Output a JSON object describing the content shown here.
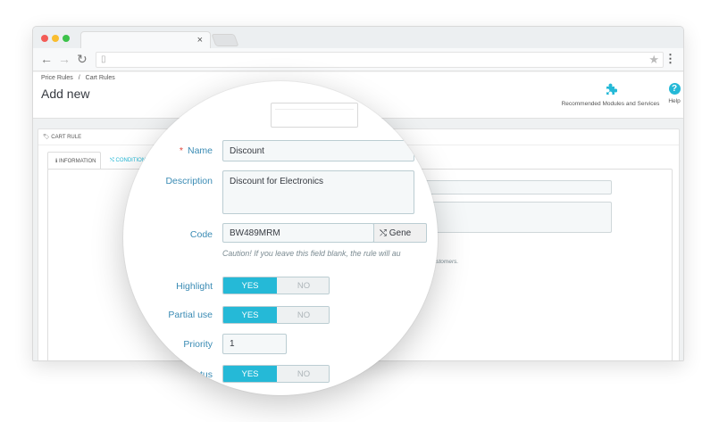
{
  "browser": {
    "close_glyph": "×",
    "nav": {
      "back": "←",
      "forward": "→",
      "reload": "↻",
      "star": "★",
      "menu": "⋮"
    }
  },
  "page": {
    "breadcrumb": [
      "Price Rules",
      "/",
      "Cart Rules"
    ],
    "title": "Add new",
    "header_buttons": [
      {
        "label": "Recommended Modules and Services",
        "icon": "puzzle-icon"
      },
      {
        "label": "Help",
        "icon": "help-icon"
      }
    ],
    "accent_color": "#25b9d7"
  },
  "panel": {
    "heading_icon": "🏷",
    "heading": "CART RULE",
    "tabs": [
      {
        "icon": "ℹ",
        "label": "INFORMATION"
      },
      {
        "icon": "⤭",
        "label": "CONDITIONS"
      }
    ],
    "caution_tail": "enefiting customers."
  },
  "form": {
    "name": {
      "required_mark": "*",
      "label": "Name",
      "value": "Discount"
    },
    "description": {
      "label": "Description",
      "value": "Discount for Electronics"
    },
    "code": {
      "label": "Code",
      "value": "BW489MRM",
      "generate_icon": "⤭",
      "generate_label": "Gene"
    },
    "caution": "Caution! If you leave this field blank, the rule will au",
    "highlight": {
      "label": "Highlight",
      "yes": "YES",
      "no": "NO",
      "selected": "YES"
    },
    "partial_use": {
      "label": "Partial use",
      "yes": "YES",
      "no": "NO",
      "selected": "YES"
    },
    "priority": {
      "label": "Priority",
      "value": "1"
    },
    "status": {
      "label": "atus",
      "yes": "YES",
      "no": "NO",
      "selected": "YES"
    }
  }
}
